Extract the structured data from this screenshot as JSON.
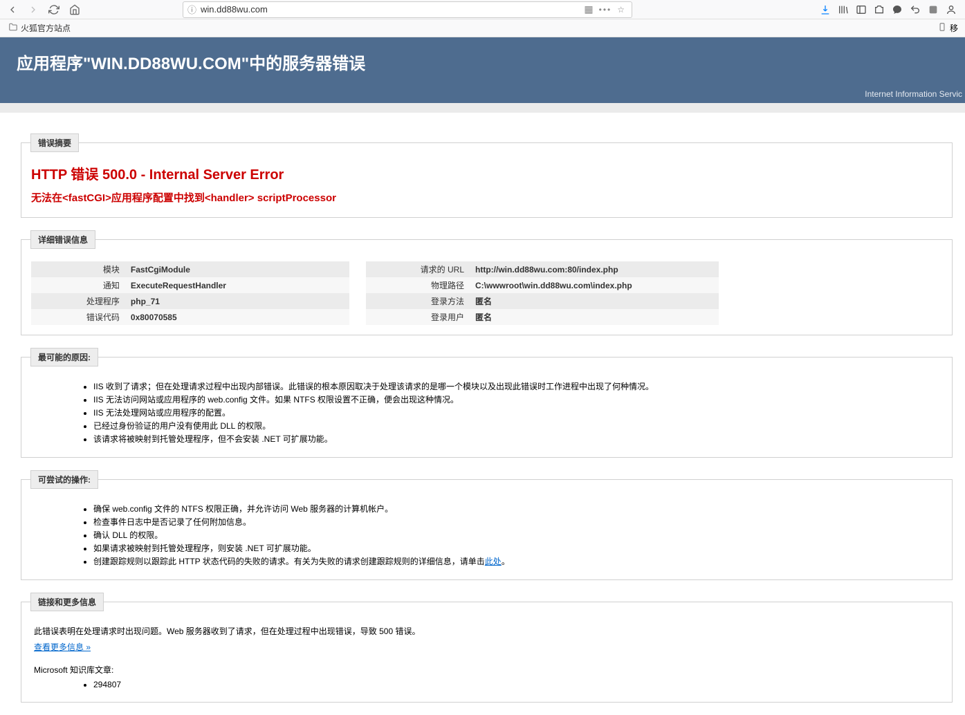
{
  "browser": {
    "url": "win.dd88wu.com",
    "bookmark_label": "火狐官方站点",
    "mobile_bookmark": "移"
  },
  "page": {
    "title": "应用程序\"WIN.DD88WU.COM\"中的服务器错误",
    "iis_label": "Internet Information Servic"
  },
  "error_summary": {
    "legend": "错误摘要",
    "title": "HTTP 错误 500.0 - Internal Server Error",
    "subtitle": "无法在<fastCGI>应用程序配置中找到<handler> scriptProcessor"
  },
  "details": {
    "legend": "详细错误信息",
    "left": [
      {
        "label": "模块",
        "value": "FastCgiModule"
      },
      {
        "label": "通知",
        "value": "ExecuteRequestHandler"
      },
      {
        "label": "处理程序",
        "value": "php_71"
      },
      {
        "label": "错误代码",
        "value": "0x80070585"
      }
    ],
    "right": [
      {
        "label": "请求的 URL",
        "value": "http://win.dd88wu.com:80/index.php"
      },
      {
        "label": "物理路径",
        "value": "C:\\wwwroot\\win.dd88wu.com\\index.php"
      },
      {
        "label": "登录方法",
        "value": "匿名"
      },
      {
        "label": "登录用户",
        "value": "匿名"
      }
    ]
  },
  "causes": {
    "legend": "最可能的原因:",
    "items": [
      "IIS 收到了请求；但在处理请求过程中出现内部错误。此错误的根本原因取决于处理该请求的是哪一个模块以及出现此错误时工作进程中出现了何种情况。",
      "IIS 无法访问网站或应用程序的 web.config 文件。如果 NTFS 权限设置不正确，便会出现这种情况。",
      "IIS 无法处理网站或应用程序的配置。",
      "已经过身份验证的用户没有使用此 DLL 的权限。",
      "该请求将被映射到托管处理程序，但不会安装 .NET 可扩展功能。"
    ]
  },
  "actions": {
    "legend": "可尝试的操作:",
    "items": [
      "确保 web.config 文件的 NTFS 权限正确，并允许访问 Web 服务器的计算机帐户。",
      "检查事件日志中是否记录了任何附加信息。",
      "确认 DLL 的权限。",
      "如果请求被映射到托管处理程序，则安装 .NET 可扩展功能。"
    ],
    "item_with_link_prefix": "创建跟踪规则以跟踪此 HTTP 状态代码的失败的请求。有关为失败的请求创建跟踪规则的详细信息，请单击",
    "link_text": "此处",
    "item_with_link_suffix": "。"
  },
  "more_info": {
    "legend": "链接和更多信息",
    "text": "此错误表明在处理请求时出现问题。Web 服务器收到了请求，但在处理过程中出现错误，导致 500 错误。",
    "view_more": "查看更多信息 »",
    "kb_label": "Microsoft 知识库文章:",
    "kb_items": [
      "294807"
    ]
  }
}
